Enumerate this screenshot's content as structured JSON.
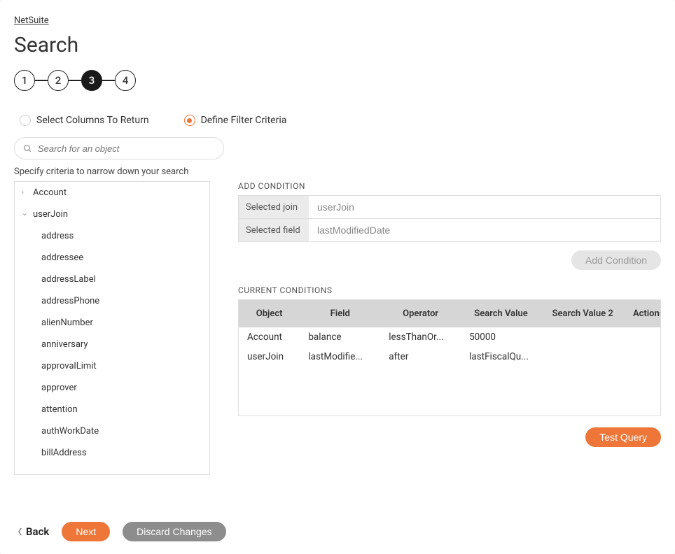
{
  "breadcrumb": "NetSuite",
  "page_title": "Search",
  "stepper": {
    "steps": [
      "1",
      "2",
      "3",
      "4"
    ],
    "active_index": 2
  },
  "radios": {
    "select_columns": "Select Columns To Return",
    "define_filter": "Define Filter Criteria"
  },
  "search": {
    "placeholder": "Search for an object"
  },
  "helper_text": "Specify criteria to narrow down your search",
  "tree": {
    "account": {
      "label": "Account",
      "expanded": false
    },
    "userJoin": {
      "label": "userJoin",
      "expanded": true,
      "children": [
        "address",
        "addressee",
        "addressLabel",
        "addressPhone",
        "alienNumber",
        "anniversary",
        "approvalLimit",
        "approver",
        "attention",
        "authWorkDate",
        "billAddress"
      ]
    }
  },
  "add_condition": {
    "section_label": "ADD CONDITION",
    "selected_join_label": "Selected join",
    "selected_join_value": "userJoin",
    "selected_field_label": "Selected field",
    "selected_field_value": "lastModifiedDate",
    "button": "Add Condition"
  },
  "conditions": {
    "section_label": "CURRENT CONDITIONS",
    "headers": {
      "object": "Object",
      "field": "Field",
      "operator": "Operator",
      "value": "Search Value",
      "value2": "Search Value 2",
      "actions": "Actions"
    },
    "rows": [
      {
        "object": "Account",
        "field": "balance",
        "operator": "lessThanOr...",
        "value": "50000",
        "value2": ""
      },
      {
        "object": "userJoin",
        "field": "lastModifie...",
        "operator": "after",
        "value": "lastFiscalQu...",
        "value2": ""
      }
    ]
  },
  "buttons": {
    "test_query": "Test Query",
    "back": "Back",
    "next": "Next",
    "discard": "Discard Changes"
  }
}
